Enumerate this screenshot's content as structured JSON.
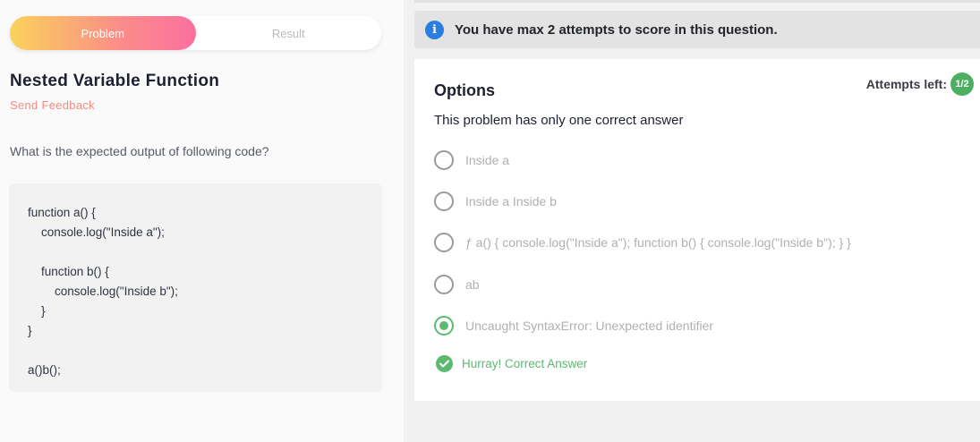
{
  "tabs": [
    {
      "label": "Problem",
      "active": true
    },
    {
      "label": "Result",
      "active": false
    }
  ],
  "problem": {
    "title": "Nested Variable Function",
    "feedback_link": "Send Feedback",
    "question": "What is the expected output of following code?",
    "code_lines": [
      "function a() {",
      "    console.log(\"Inside a\");",
      "",
      "    function b() {",
      "        console.log(\"Inside b\");",
      "    }",
      "}",
      "",
      "a()b();"
    ]
  },
  "banner": {
    "text": "You have max 2 attempts to score in this question.",
    "icon": "info-icon",
    "color": "#2a7de1"
  },
  "options_panel": {
    "heading": "Options",
    "attempts_label": "Attempts left:",
    "attempts_value": "1/2",
    "instruction": "This problem has only one correct answer",
    "options": [
      {
        "label": "Inside a",
        "selected": false
      },
      {
        "label": "Inside a Inside b",
        "selected": false
      },
      {
        "label": "ƒ a() { console.log(\"Inside a\"); function b() { console.log(\"Inside b\"); } }",
        "selected": false
      },
      {
        "label": "ab",
        "selected": false
      },
      {
        "label": "Uncaught SyntaxError: Unexpected identifier",
        "selected": true
      }
    ],
    "result_text": "Hurray! Correct Answer",
    "success_color": "#5cba70"
  }
}
